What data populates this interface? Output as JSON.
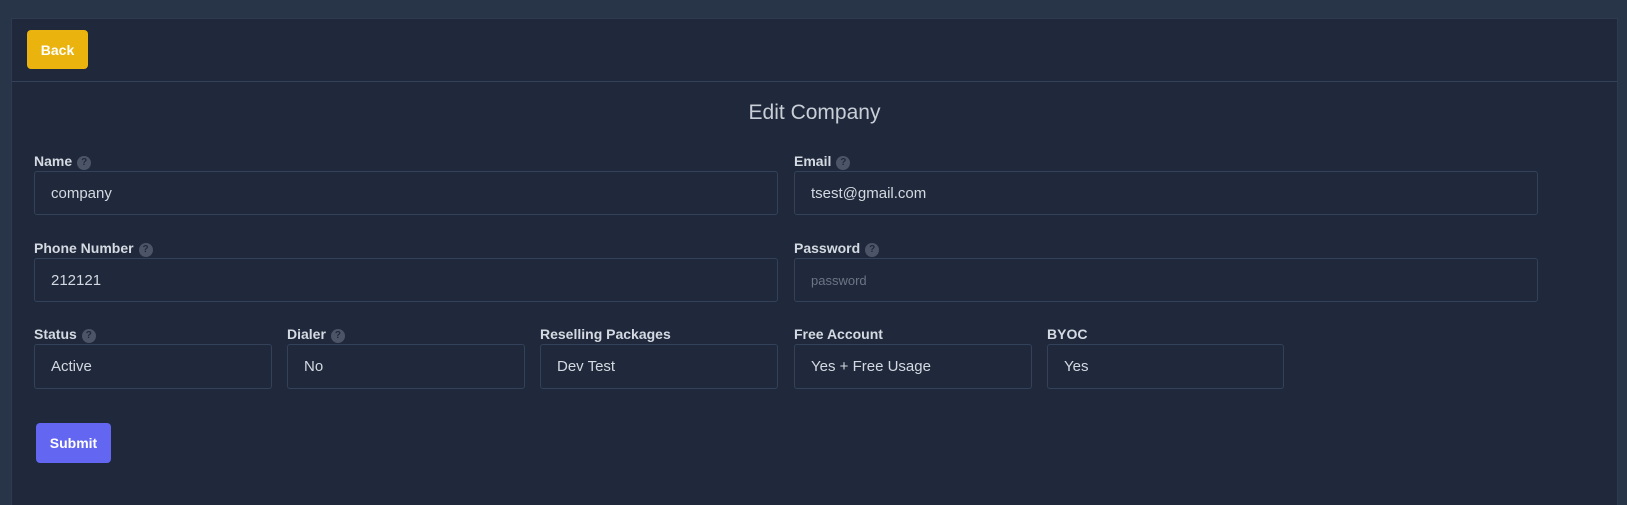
{
  "header": {
    "back_label": "Back"
  },
  "form": {
    "title": "Edit Company",
    "name": {
      "label": "Name",
      "value": "company"
    },
    "email": {
      "label": "Email",
      "value": "tsest@gmail.com"
    },
    "phone": {
      "label": "Phone Number",
      "value": "212121"
    },
    "password": {
      "label": "Password",
      "value": "",
      "placeholder": "password"
    },
    "status": {
      "label": "Status",
      "value": "Active"
    },
    "dialer": {
      "label": "Dialer",
      "value": "No"
    },
    "reselling": {
      "label": "Reselling Packages",
      "value": "Dev Test"
    },
    "free_account": {
      "label": "Free Account",
      "value": "Yes + Free Usage"
    },
    "byoc": {
      "label": "BYOC",
      "value": "Yes"
    },
    "submit_label": "Submit"
  },
  "icons": {
    "help": "question-circle-icon"
  },
  "colors": {
    "background": "#283549",
    "card": "#1f293b",
    "back_button": "#eab30d",
    "submit_button": "#6366f1"
  }
}
